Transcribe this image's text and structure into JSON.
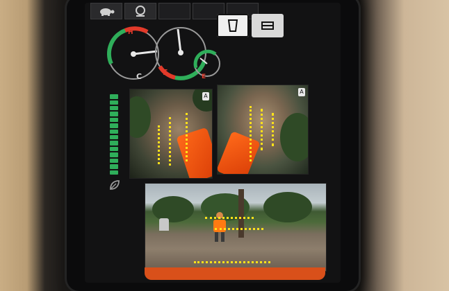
{
  "topbar": {
    "icons": [
      "turtle-icon",
      "speed-mode-icon"
    ]
  },
  "gauges": {
    "left_label": "C",
    "left_scale_top": "H",
    "middle_label": "E",
    "right_label": "E"
  },
  "mode_buttons": [
    "bucket-mode-icon",
    "dozer-mode-icon"
  ],
  "level_bar": {
    "segments": 14,
    "level": 1.0
  },
  "colors": {
    "accent_green": "#2fae5a",
    "warning_red": "#e23a2a",
    "bucket_orange": "#ff6a1a",
    "guide_yellow": "#ffe21a"
  },
  "cameras": [
    {
      "name": "front-left-camera",
      "badge": "A"
    },
    {
      "name": "front-right-camera",
      "badge": "A"
    },
    {
      "name": "rear-camera",
      "badge": ""
    }
  ]
}
